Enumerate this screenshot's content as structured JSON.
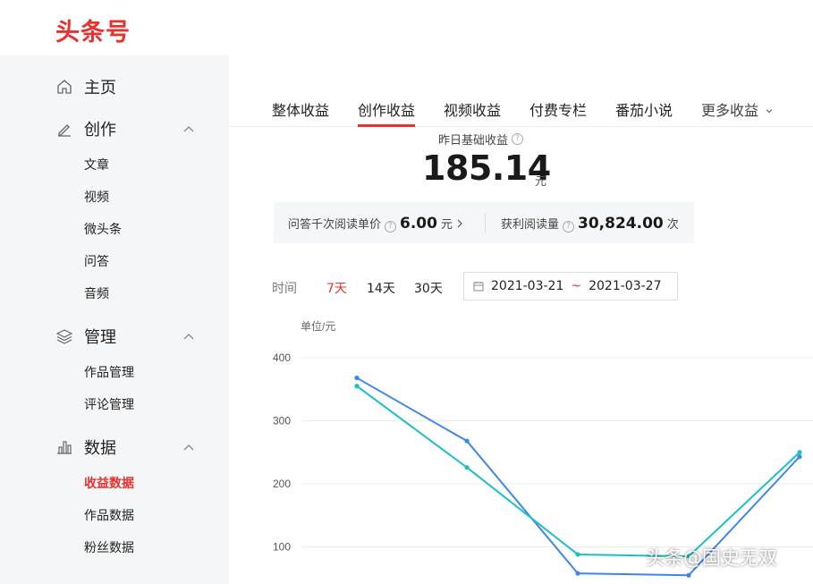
{
  "brand": {
    "logo_text": "头条号",
    "accent": "#e8312f"
  },
  "sidebar": {
    "home": "主页",
    "create": {
      "label": "创作",
      "items": [
        "文章",
        "视频",
        "微头条",
        "问答",
        "音频"
      ]
    },
    "manage": {
      "label": "管理",
      "items": [
        "作品管理",
        "评论管理"
      ]
    },
    "data": {
      "label": "数据",
      "items": [
        "收益数据",
        "作品数据",
        "粉丝数据"
      ],
      "active": "收益数据"
    }
  },
  "tabs": [
    "整体收益",
    "创作收益",
    "视频收益",
    "付费专栏",
    "番茄小说",
    "更多收益"
  ],
  "active_tab": "创作收益",
  "summary": {
    "label": "昨日基础收益",
    "value": "185.14",
    "unit": "元"
  },
  "stats": {
    "qa_label": "问答千次阅读单价",
    "qa_value": "6.00",
    "qa_unit": "元",
    "reads_label": "获利阅读量",
    "reads_value": "30,824.00",
    "reads_unit": "次"
  },
  "filters": {
    "label": "时间",
    "options": [
      "7天",
      "14天",
      "30天"
    ],
    "active": "7天",
    "date_start": "2021-03-21",
    "date_sep": "~",
    "date_end": "2021-03-27"
  },
  "chart_data": {
    "type": "line",
    "ylabel": "单位/元",
    "yticks": [
      100,
      200,
      300,
      400
    ],
    "ylim": [
      0,
      400
    ],
    "grid": true,
    "x": [
      1,
      2,
      3,
      4,
      5
    ],
    "series": [
      {
        "color": "#3f86e8",
        "values": [
          368,
          268,
          58,
          55,
          243
        ]
      },
      {
        "color": "#1bbfc6",
        "values": [
          355,
          226,
          88,
          85,
          250
        ]
      }
    ]
  },
  "watermark": "头条@国史无双"
}
